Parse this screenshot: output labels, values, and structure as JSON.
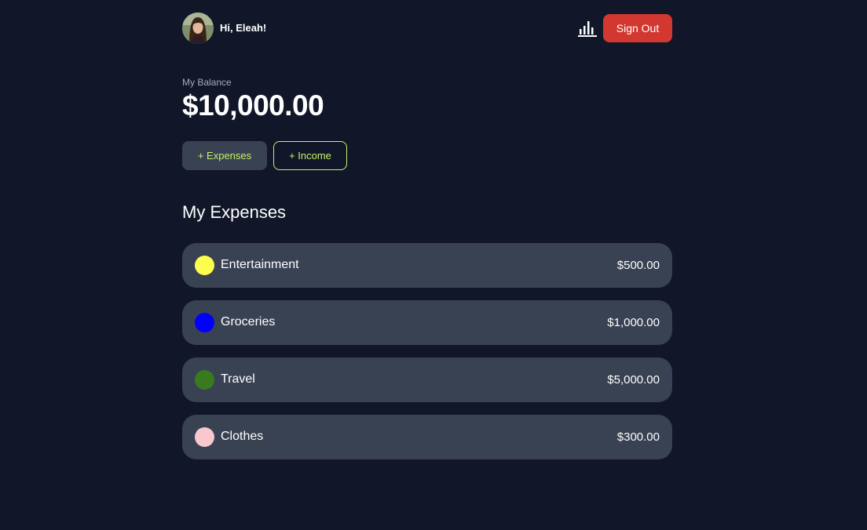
{
  "header": {
    "greeting": "Hi, Eleah!",
    "stats_icon": "bar-chart-icon",
    "signout_label": "Sign Out"
  },
  "balance": {
    "label": "My Balance",
    "amount": "$10,000.00"
  },
  "actions": {
    "expenses_label": "+ Expenses",
    "income_label": "+ Income"
  },
  "expenses": {
    "title": "My Expenses",
    "items": [
      {
        "name": "Entertainment",
        "amount": "$500.00",
        "color": "#fdfd4e"
      },
      {
        "name": "Groceries",
        "amount": "$1,000.00",
        "color": "#0000fb"
      },
      {
        "name": "Travel",
        "amount": "$5,000.00",
        "color": "#3a7a1e"
      },
      {
        "name": "Clothes",
        "amount": "$300.00",
        "color": "#f8c8cf"
      }
    ]
  },
  "colors": {
    "background": "#111728",
    "card": "#394253",
    "accent": "#c6f06a",
    "signout": "#d2382f"
  }
}
